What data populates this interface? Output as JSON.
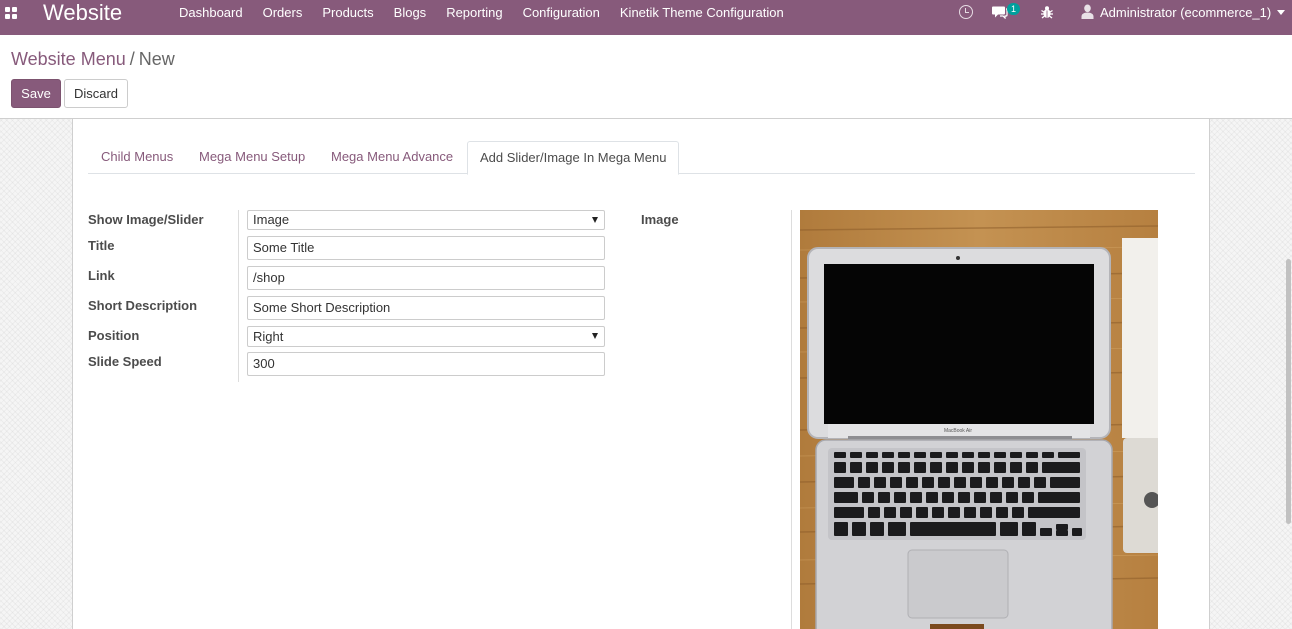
{
  "navbar": {
    "brand": "Website",
    "menu": [
      "Dashboard",
      "Orders",
      "Products",
      "Blogs",
      "Reporting",
      "Configuration",
      "Kinetik Theme Configuration"
    ],
    "chat_count": "1",
    "user": "Administrator (ecommerce_1)",
    "color": "#875a7b"
  },
  "breadcrumb": {
    "parent": "Website Menu",
    "separator": "/",
    "current": "New"
  },
  "buttons": {
    "save": "Save",
    "discard": "Discard"
  },
  "tabs": [
    "Child Menus",
    "Mega Menu Setup",
    "Mega Menu Advance",
    "Add Slider/Image In Mega Menu"
  ],
  "active_tab": "Add Slider/Image In Mega Menu",
  "form": {
    "show_image_slider": {
      "label": "Show Image/Slider",
      "value": "Image"
    },
    "title": {
      "label": "Title",
      "value": "Some Title"
    },
    "link": {
      "label": "Link",
      "value": "/shop"
    },
    "short_description": {
      "label": "Short Description",
      "value": "Some Short Description"
    },
    "position": {
      "label": "Position",
      "value": "Right"
    },
    "slide_speed": {
      "label": "Slide Speed",
      "value": "300"
    },
    "image": {
      "label": "Image",
      "laptop_brand": "MacBook Air"
    }
  }
}
